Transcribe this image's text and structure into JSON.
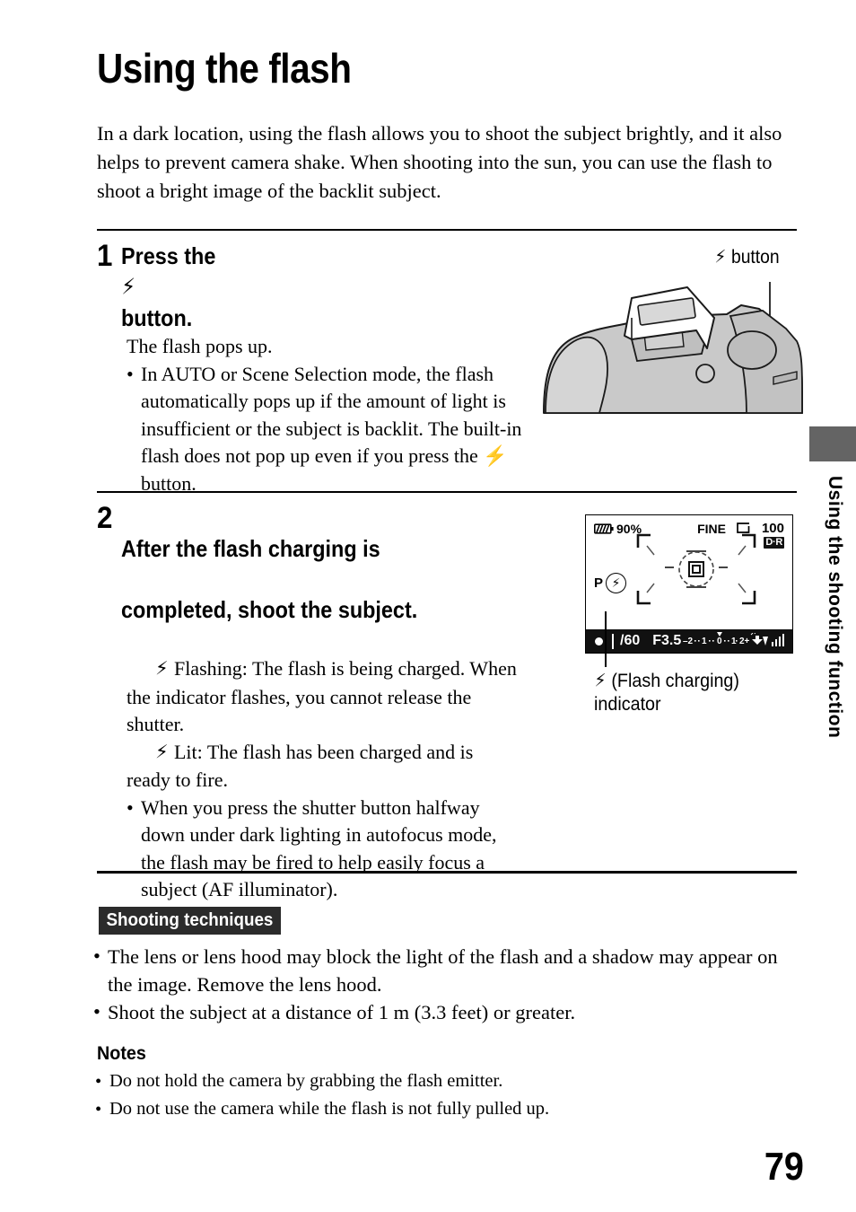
{
  "document": {
    "title": "Using the flash",
    "page_number": "79",
    "side_tab_label": "Using the shooting function",
    "side_tab_color": "#646464"
  },
  "intro": {
    "text": "In a dark location, using the flash allows you to shoot the subject brightly, and it also helps to prevent camera shake. When shooting into the sun, you can use the flash to shoot a bright image of the backlit subject."
  },
  "steps": [
    {
      "number": "1",
      "title": "Press the ⚡ button.",
      "title_pre": "Press the",
      "title_post": "button.",
      "lead": "The flash pops up.",
      "bullets": [
        "In AUTO or Scene Selection mode, the flash automatically pops up if the amount of light is insufficient or the subject is backlit. The built-in flash does not pop up even if you press the ⚡ button."
      ]
    },
    {
      "number": "2",
      "title_line1": "After the flash charging is",
      "title_line2": "completed, shoot the subject.",
      "para1": "Flashing: The flash is being charged. When the indicator flashes, you cannot release the shutter.",
      "para2": "Lit: The flash has been charged and is ready to fire.",
      "bullets": [
        "When you press the shutter button halfway down under dark lighting in autofocus mode, the flash may be fired to help easily focus a subject (AF illuminator)."
      ]
    }
  ],
  "camera_figure": {
    "callout_label": "button",
    "callout_icon": "flash-bolt-icon"
  },
  "lcd_figure": {
    "battery_percent": "90%",
    "quality": "FINE",
    "image_size_icon": "image-size-large-icon",
    "shots_remaining": "100",
    "dro_badge": "D·R",
    "mode": "P",
    "flash_indicator_icon": "flash-bolt-icon",
    "shutter_speed": "/60",
    "aperture": "F3.5",
    "ev_scale": "–2··1··0··1··2+",
    "steady_shot_icon": "steady-shot-icon",
    "caption_line1": "(Flash charging)",
    "caption_line2": "indicator"
  },
  "shooting_techniques": {
    "badge": "Shooting techniques",
    "bullets": [
      "The lens or lens hood may block the light of the flash and a shadow may appear on the image. Remove the lens hood.",
      "Shoot the subject at a distance of 1 m (3.3 feet) or greater."
    ]
  },
  "notes": {
    "heading": "Notes",
    "bullets": [
      "Do not hold the camera by grabbing the flash emitter.",
      "Do not use the camera while the flash is not fully pulled up."
    ]
  }
}
